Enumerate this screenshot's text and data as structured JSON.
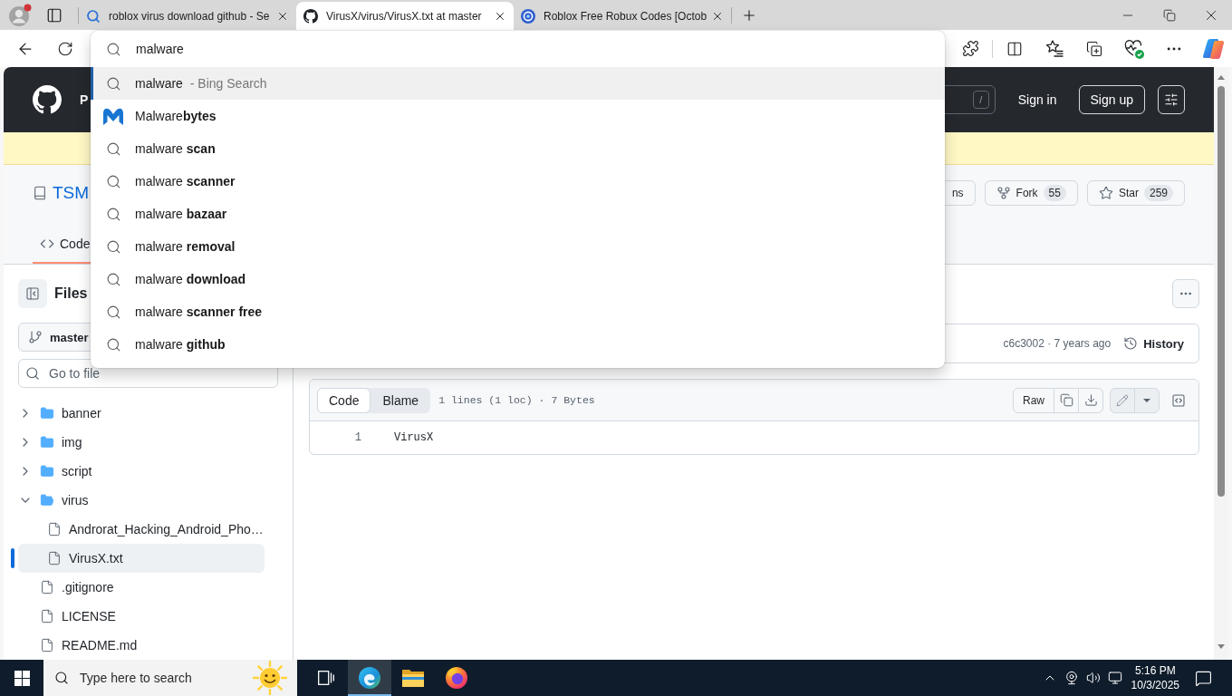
{
  "browser": {
    "tabs": [
      {
        "kind": "search",
        "title": "roblox virus download github - Se",
        "selected": false
      },
      {
        "kind": "github",
        "title": "VirusX/virus/VirusX.txt at master",
        "selected": true
      },
      {
        "kind": "globe",
        "title": "Roblox Free Robux Codes [Octob",
        "selected": false
      }
    ],
    "address": {
      "value": "malware"
    },
    "suggestions": [
      {
        "kind": "search",
        "text": "malware",
        "hint": "- Bing Search",
        "selected": true
      },
      {
        "kind": "site",
        "text": "Malware**bytes**",
        "selected": false
      },
      {
        "kind": "search",
        "text": "malware **scan**",
        "selected": false
      },
      {
        "kind": "search",
        "text": "malware **scanner**",
        "selected": false
      },
      {
        "kind": "search",
        "text": "malware **bazaar**",
        "selected": false
      },
      {
        "kind": "search",
        "text": "malware **removal**",
        "selected": false
      },
      {
        "kind": "search",
        "text": "malware **download**",
        "selected": false
      },
      {
        "kind": "search",
        "text": "malware **scanner free**",
        "selected": false
      },
      {
        "kind": "search",
        "text": "malware **github**",
        "selected": false
      }
    ]
  },
  "github": {
    "header": {
      "nav": "P",
      "search_key": "/",
      "sign_in": "Sign in",
      "sign_up": "Sign up"
    },
    "repo": {
      "name": "TSM",
      "actions": [
        {
          "kind": "notifications",
          "label": "ns"
        },
        {
          "kind": "fork",
          "label": "Fork",
          "count": "55"
        },
        {
          "kind": "star",
          "label": "Star",
          "count": "259"
        }
      ],
      "tabs": [
        {
          "label": "Code",
          "selected": true
        }
      ]
    },
    "sidebar": {
      "title": "Files",
      "branch": "master",
      "search": {
        "placeholder": "Go to file"
      },
      "tree": [
        {
          "kind": "folder",
          "name": "banner",
          "expanded": false,
          "selected": false
        },
        {
          "kind": "folder",
          "name": "img",
          "expanded": false,
          "selected": false
        },
        {
          "kind": "folder",
          "name": "script",
          "expanded": false,
          "selected": false
        },
        {
          "kind": "folder",
          "name": "virus",
          "expanded": true,
          "selected": false,
          "children": [
            {
              "kind": "file",
              "name": "Androrat_Hacking_Android_Pho…",
              "selected": false
            },
            {
              "kind": "file",
              "name": "VirusX.txt",
              "selected": true
            }
          ]
        },
        {
          "kind": "file",
          "name": ".gitignore",
          "selected": false
        },
        {
          "kind": "file",
          "name": "LICENSE",
          "selected": false
        },
        {
          "kind": "file",
          "name": "README.md",
          "selected": false
        }
      ]
    },
    "commit": {
      "summary": "c6c3002 · 7 years ago",
      "history": "History"
    },
    "file": {
      "views": [
        {
          "label": "Code",
          "selected": true
        },
        {
          "label": "Blame",
          "selected": false
        }
      ],
      "info": "1 lines (1 loc) · 7 Bytes",
      "raw": "Raw",
      "lines": [
        {
          "number": "1",
          "text": "VirusX"
        }
      ]
    }
  },
  "taskbar": {
    "search": {
      "placeholder": "Type here to search"
    },
    "apps": [
      {
        "kind": "task-view",
        "active": false
      },
      {
        "kind": "edge",
        "active": true
      },
      {
        "kind": "explorer",
        "active": false
      },
      {
        "kind": "firefox",
        "active": false
      }
    ],
    "time": "5:16 PM",
    "date": "10/3/2025"
  }
}
